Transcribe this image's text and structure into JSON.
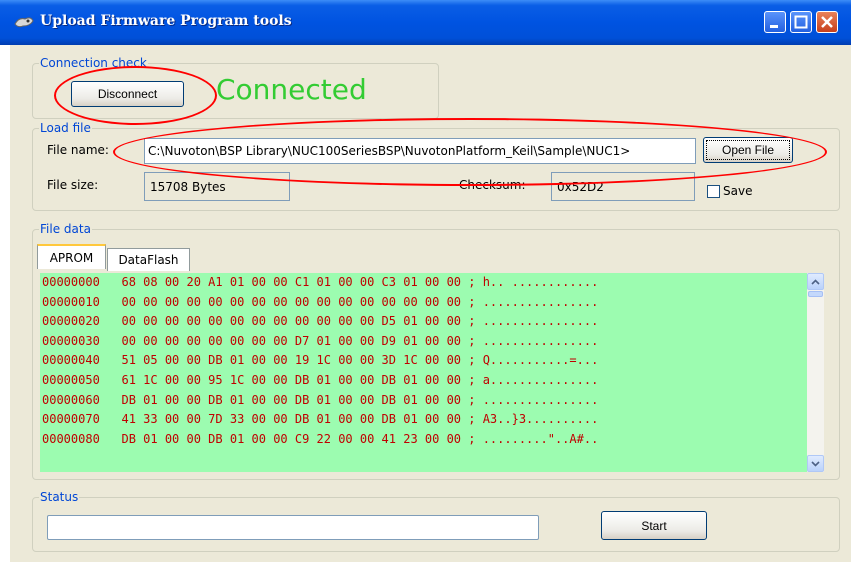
{
  "window": {
    "title": "Upload Firmware Program tools"
  },
  "connection": {
    "group_label": "Connection check",
    "disconnect_label": "Disconnect",
    "status_text": "Connected"
  },
  "load_file": {
    "group_label": "Load file",
    "file_name_label": "File name:",
    "file_name_value": "C:\\Nuvoton\\BSP Library\\NUC100SeriesBSP\\NuvotonPlatform_Keil\\Sample\\NUC1>",
    "open_file_label": "Open File",
    "file_size_label": "File size:",
    "file_size_value": "15708 Bytes",
    "checksum_label": "Checksum:",
    "checksum_value": "0x52D2",
    "save_label": "Save"
  },
  "file_data": {
    "group_label": "File data",
    "tabs": [
      "APROM",
      "DataFlash"
    ],
    "rows": [
      "00000000   68 08 00 20 A1 01 00 00 C1 01 00 00 C3 01 00 00 ; h.. ............",
      "00000010   00 00 00 00 00 00 00 00 00 00 00 00 00 00 00 00 ; ................",
      "00000020   00 00 00 00 00 00 00 00 00 00 00 00 D5 01 00 00 ; ................",
      "00000030   00 00 00 00 00 00 00 00 D7 01 00 00 D9 01 00 00 ; ................",
      "00000040   51 05 00 00 DB 01 00 00 19 1C 00 00 3D 1C 00 00 ; Q...........=...",
      "00000050   61 1C 00 00 95 1C 00 00 DB 01 00 00 DB 01 00 00 ; a...............",
      "00000060   DB 01 00 00 DB 01 00 00 DB 01 00 00 DB 01 00 00 ; ................",
      "00000070   41 33 00 00 7D 33 00 00 DB 01 00 00 DB 01 00 00 ; A3..}3..........",
      "00000080   DB 01 00 00 DB 01 00 00 C9 22 00 00 41 23 00 00 ; .........\"..A#.."
    ]
  },
  "status": {
    "group_label": "Status",
    "start_label": "Start"
  },
  "colors": {
    "accent": "#0046d5",
    "hex_bg": "#9cfcb0",
    "hex_text": "#c00000",
    "annotation": "#ff0000",
    "connected": "#33cc33"
  }
}
